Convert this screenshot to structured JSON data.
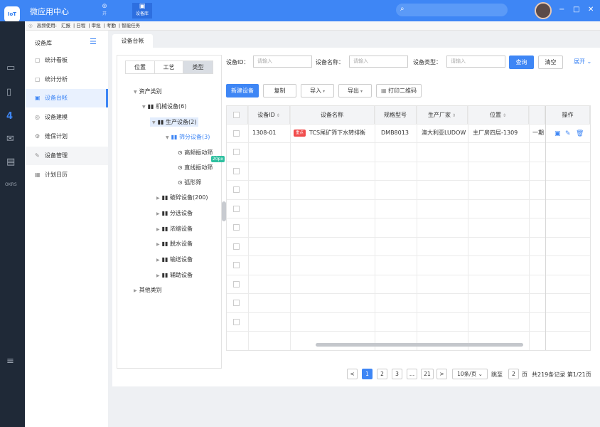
{
  "app": {
    "logo": "IoT",
    "title": "微应用中心"
  },
  "top_icons": [
    {
      "glyph": "⊕",
      "label": "开",
      "active": false
    },
    {
      "glyph": "▣",
      "label": "设备库",
      "active": true
    }
  ],
  "search": {
    "placeholder": ""
  },
  "window_controls": [
    "−",
    "□",
    "✕"
  ],
  "quickbar": {
    "prefix": "高频使用:",
    "items": [
      "汇报",
      "日程",
      "审批",
      "考勤",
      "智能任务"
    ]
  },
  "rail": {
    "okrs_label": "OKRS"
  },
  "sidebar": {
    "title": "设备库",
    "items": [
      {
        "label": "统计看板",
        "icon": "board-icon"
      },
      {
        "label": "统计分析",
        "icon": "analysis-icon"
      },
      {
        "label": "设备台帐",
        "icon": "ledger-icon",
        "active": true
      },
      {
        "label": "设备建模",
        "icon": "model-icon"
      },
      {
        "label": "维保计划",
        "icon": "maintenance-icon"
      },
      {
        "label": "设备管理",
        "icon": "manage-icon"
      },
      {
        "label": "计划日历",
        "icon": "calendar-icon"
      }
    ]
  },
  "tab": {
    "label": "设备台帐"
  },
  "tree": {
    "segments": [
      "位置",
      "工艺",
      "类型"
    ],
    "nodes": {
      "asset": "资产类别",
      "mech": "机械设备(6)",
      "prod": "生产设备(2)",
      "screen": "筛分设备(3)",
      "hf": "高频振动筛",
      "linear": "直线振动筛",
      "arc": "弧形筛",
      "crush": "破碎设备(200)",
      "sorting": "分选设备",
      "thicken": "浓缩设备",
      "dewater": "脱水设备",
      "convey": "输送设备",
      "aux": "辅助设备",
      "other": "其他类别"
    },
    "size_badge": "20px"
  },
  "filters": {
    "id_label": "设备ID：",
    "name_label": "设备名称：",
    "type_label": "设备类型：",
    "placeholder": "请输入",
    "query": "查询",
    "clear": "清空",
    "expand": "展开"
  },
  "actions": {
    "new": "新建设备",
    "copy": "复制",
    "import": "导入",
    "export": "导出",
    "print": "打印二维码"
  },
  "table": {
    "headers": [
      "设备ID",
      "设备名称",
      "规格型号",
      "生产厂家",
      "位置",
      "",
      "操作"
    ],
    "rows": [
      {
        "id": "1308-01",
        "tag": "重点",
        "name": "TCS尾矿筛下水转排衡",
        "model": "DMB8013",
        "maker": "澳大利亚LUDOW",
        "location": "主厂房四层-1309",
        "extra": "一期"
      }
    ]
  },
  "pagination": {
    "pages": [
      "1",
      "2",
      "3",
      "...",
      "21"
    ],
    "prev": "<",
    "next": ">",
    "page_size": "10条/页",
    "jump_label": "跳至",
    "jump_value": "2",
    "page_suffix": "页",
    "summary": "共219条记录 第1/21页"
  }
}
